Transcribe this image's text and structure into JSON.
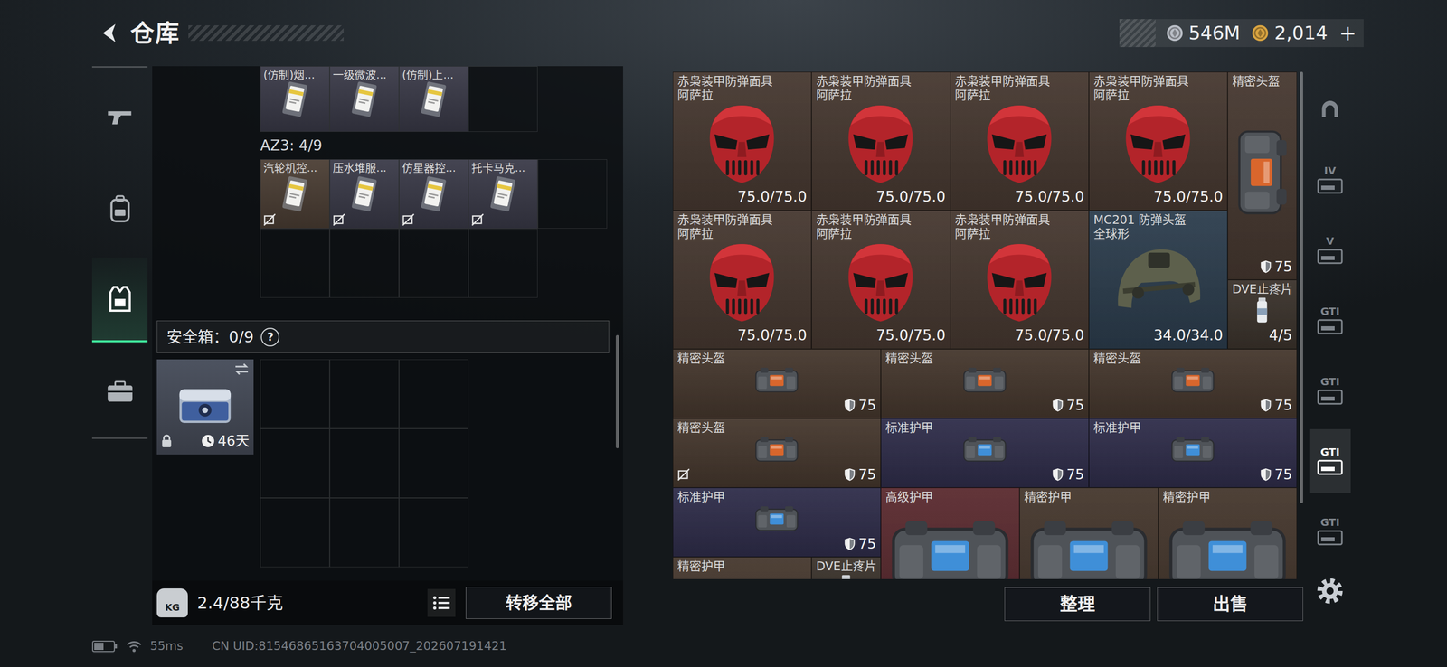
{
  "header": {
    "title": "仓库",
    "currencies": [
      {
        "amount": "546M",
        "color": "#b9bec6"
      },
      {
        "amount": "2,014",
        "color": "#d9a441"
      }
    ],
    "add": "+"
  },
  "left_rail": [
    {
      "selected": false
    },
    {
      "selected": false
    },
    {
      "selected": true
    },
    {
      "selected": false
    }
  ],
  "storage": {
    "top_row": [
      {
        "name": "(仿制)烟...",
        "color": "#393947"
      },
      {
        "name": "一级微波...",
        "color": "#393947"
      },
      {
        "name": "(仿制)上...",
        "color": "#393947"
      }
    ],
    "az3": {
      "label": "AZ3: 4/9",
      "items": [
        {
          "name": "汽轮机控...",
          "color": "#4a3d33",
          "untradeable": true
        },
        {
          "name": "压水堆服...",
          "color": "#393947",
          "untradeable": true
        },
        {
          "name": "仿星器控...",
          "color": "#393947",
          "untradeable": true
        },
        {
          "name": "托卡马克...",
          "color": "#393947",
          "untradeable": true
        }
      ]
    },
    "safe": {
      "label": "安全箱：0/9",
      "help": "?",
      "case": {
        "days": "46天",
        "locked": true
      }
    },
    "weight_icon": "KG",
    "weight": "2.4/88千克",
    "transfer": "转移全部",
    "scroll_level": 0.67
  },
  "inventory": {
    "scroll_level": 0.0,
    "items": [
      {
        "kind": "mask",
        "name": "赤枭装甲防弹面具",
        "sub": "阿萨拉",
        "reading": "75.0/75.0",
        "color": "#463830",
        "untradeable": false
      },
      {
        "kind": "mask",
        "name": "赤枭装甲防弹面具",
        "sub": "阿萨拉",
        "reading": "75.0/75.0",
        "color": "#463830",
        "untradeable": false
      },
      {
        "kind": "mask",
        "name": "赤枭装甲防弹面具",
        "sub": "阿萨拉",
        "reading": "75.0/75.0",
        "color": "#463830",
        "untradeable": false
      },
      {
        "kind": "mask",
        "name": "赤枭装甲防弹面具",
        "sub": "阿萨拉",
        "reading": "75.0/75.0",
        "color": "#463830",
        "untradeable": false
      },
      {
        "kind": "rig",
        "name": "精密头盔",
        "armor": "75",
        "color": "#463830",
        "untradeable": false
      },
      {
        "kind": "mask",
        "name": "赤枭装甲防弹面具",
        "sub": "阿萨拉",
        "reading": "75.0/75.0",
        "color": "#463830",
        "untradeable": false
      },
      {
        "kind": "mask",
        "name": "赤枭装甲防弹面具",
        "sub": "阿萨拉",
        "reading": "75.0/75.0",
        "color": "#463830",
        "untradeable": false
      },
      {
        "kind": "mask",
        "name": "赤枭装甲防弹面具",
        "sub": "阿萨拉",
        "reading": "75.0/75.0",
        "color": "#463830",
        "untradeable": false
      },
      {
        "kind": "helmet",
        "name": "MC201 防弹头盔",
        "sub": "全球形",
        "reading": "34.0/34.0",
        "color": "#2c3d4d",
        "untradeable": false
      },
      {
        "kind": "pills",
        "name": "DVE止疼片",
        "reading": "4/5",
        "color": "#3b332c",
        "untradeable": false
      },
      {
        "kind": "rig",
        "name": "精密头盔",
        "armor": "75",
        "color": "#45372d",
        "untradeable": false
      },
      {
        "kind": "rig",
        "name": "精密头盔",
        "armor": "75",
        "color": "#45372d",
        "untradeable": false
      },
      {
        "kind": "rig",
        "name": "精密头盔",
        "armor": "75",
        "color": "#45372d",
        "untradeable": false
      },
      {
        "kind": "rig",
        "name": "精密头盔",
        "armor": "75",
        "color": "#45372d",
        "untradeable": true
      },
      {
        "kind": "armor",
        "name": "标准护甲",
        "armor": "75",
        "color": "#2f2d4a",
        "untradeable": false
      },
      {
        "kind": "armor",
        "name": "标准护甲",
        "armor": "75",
        "color": "#2f2d4a",
        "untradeable": false
      },
      {
        "kind": "armor",
        "name": "标准护甲",
        "armor": "75",
        "color": "#2f2d4a",
        "untradeable": false
      },
      {
        "kind": "armor",
        "name": "高级护甲",
        "color": "#5a2a2f",
        "untradeable": false
      },
      {
        "kind": "armor",
        "name": "精密护甲",
        "color": "#45372d",
        "untradeable": false
      },
      {
        "kind": "armor",
        "name": "精密护甲",
        "color": "#45372d",
        "untradeable": false
      },
      {
        "kind": "armor",
        "name": "精密护甲",
        "color": "#45372d",
        "untradeable": false
      },
      {
        "kind": "pills",
        "name": "DVE止疼片",
        "color": "#3b332c",
        "untradeable": false
      }
    ]
  },
  "actions": [
    "整理",
    "出售"
  ],
  "right_rail": [
    {
      "selected": false
    },
    {
      "label": "IV",
      "selected": false
    },
    {
      "label": "V",
      "selected": false
    },
    {
      "label": "GTI",
      "selected": false
    },
    {
      "label": "GTI",
      "selected": false
    },
    {
      "label": "GTI",
      "selected": true
    },
    {
      "label": "GTI",
      "selected": false
    }
  ],
  "status": {
    "battery": {
      "level": 0.5
    },
    "ping": "55ms",
    "uid": "CN UID:81546865163704005007_202607191421"
  }
}
